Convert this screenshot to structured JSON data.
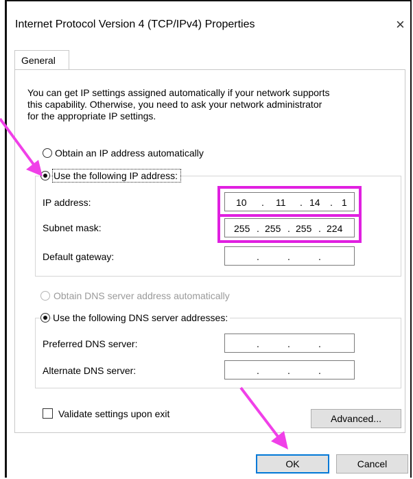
{
  "window": {
    "title": "Internet Protocol Version 4 (TCP/IPv4) Properties",
    "close_glyph": "×"
  },
  "tabs": [
    {
      "label": "General"
    }
  ],
  "intro_lines": [
    "You can get IP settings assigned automatically if your network supports",
    "this capability. Otherwise, you need to ask your network administrator",
    "for the appropriate IP settings."
  ],
  "ip_section": {
    "auto_label": "Obtain an IP address automatically",
    "manual_label": "Use the following IP address:",
    "selected": "manual",
    "fields": [
      {
        "label": "IP address:",
        "octets": [
          "10",
          "11",
          "14",
          "1"
        ]
      },
      {
        "label": "Subnet mask:",
        "octets": [
          "255",
          "255",
          "255",
          "224"
        ]
      },
      {
        "label": "Default gateway:",
        "octets": [
          "",
          "",
          "",
          ""
        ]
      }
    ]
  },
  "dns_section": {
    "auto_label": "Obtain DNS server address automatically",
    "manual_label": "Use the following DNS server addresses:",
    "selected": "manual",
    "fields": [
      {
        "label": "Preferred DNS server:",
        "octets": [
          "",
          "",
          "",
          ""
        ]
      },
      {
        "label": "Alternate DNS server:",
        "octets": [
          "",
          "",
          "",
          ""
        ]
      }
    ]
  },
  "validate": {
    "label": "Validate settings upon exit",
    "checked": false
  },
  "buttons": {
    "advanced": "Advanced...",
    "ok": "OK",
    "cancel": "Cancel"
  },
  "annotation_colors": {
    "highlight": "#e020e0",
    "arrow": "#f040e8"
  },
  "ip_separator": "."
}
